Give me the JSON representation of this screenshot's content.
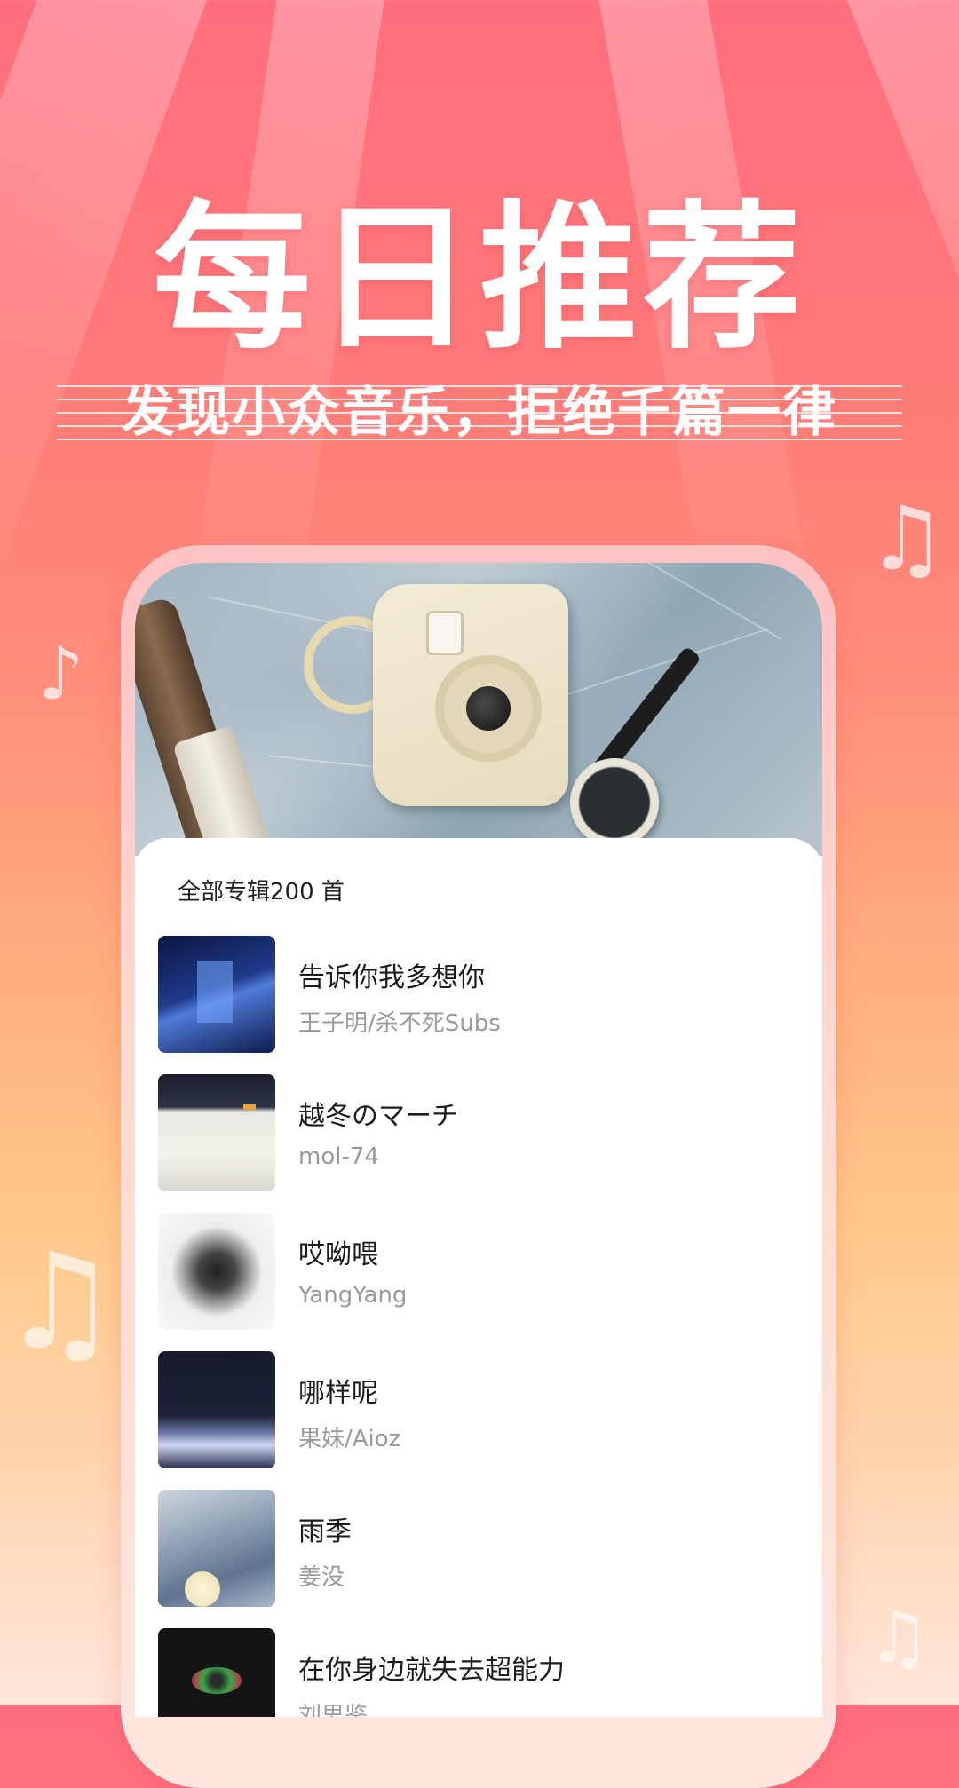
{
  "hero": {
    "headline": "每日推荐",
    "subheadline": "发现小众音乐，拒绝千篇一律"
  },
  "decor": {
    "note_icons": [
      "music-note-icon",
      "music-note-icon",
      "double-music-note-icon",
      "double-music-note-icon"
    ]
  },
  "list": {
    "header": "全部专辑200 首",
    "tracks": [
      {
        "title": "告诉你我多想你",
        "artist": "王子明/杀不死Subs",
        "cover": "blue-room-cover"
      },
      {
        "title": "越冬のマーチ",
        "artist": "mol-74",
        "cover": "snow-field-cover"
      },
      {
        "title": "哎呦喂",
        "artist": "YangYang",
        "cover": "burst-x-cover"
      },
      {
        "title": "哪样呢",
        "artist": "果妹/Aioz",
        "cover": "night-cloud-cover"
      },
      {
        "title": "雨季",
        "artist": "姜没",
        "cover": "girl-moon-cover"
      },
      {
        "title": "在你身边就失去超能力",
        "artist": "刘思鉴",
        "cover": "lips-cover"
      }
    ]
  },
  "colors": {
    "bg_top": "#ff6e7f",
    "bg_bottom": "#ffe6da",
    "text_primary": "#1c1c1c",
    "text_secondary": "#9a9a9a"
  }
}
